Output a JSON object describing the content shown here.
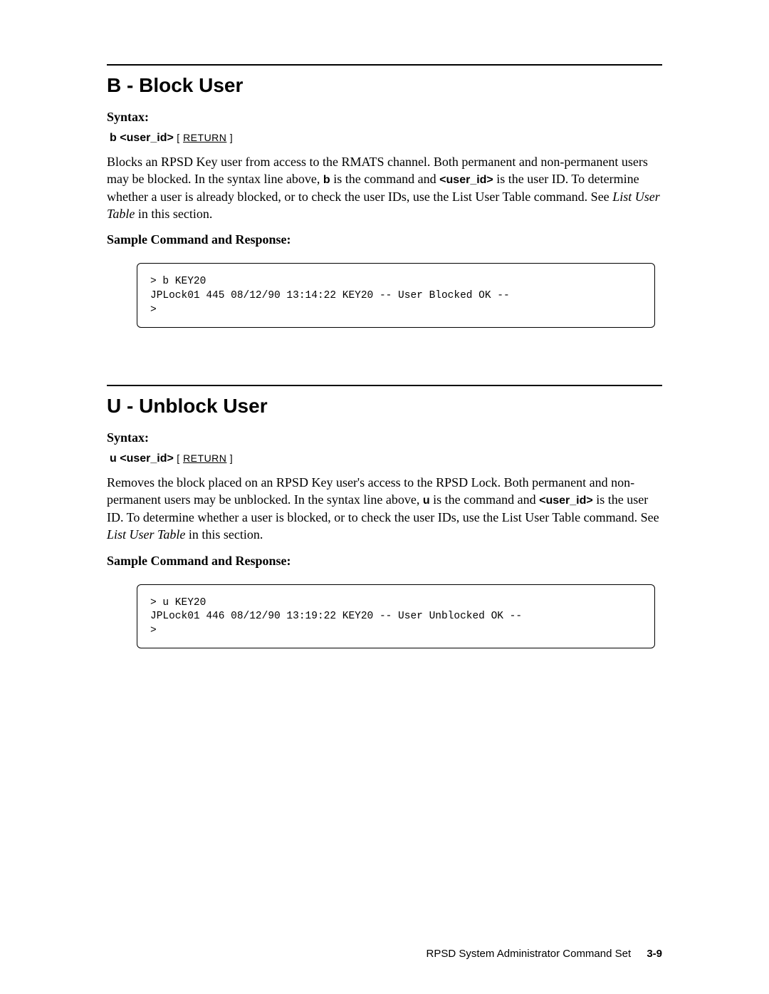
{
  "section1": {
    "title": "B - Block User",
    "syntax_label": "Syntax:",
    "syntax_cmd": "b <user_id>",
    "return_open": "[ ",
    "return_label": "RETURN",
    "return_close": " ]",
    "para_part1": "Blocks an RPSD Key user from access to the RMATS channel. Both permanent and non-permanent users may be blocked. In the syntax line above, ",
    "para_b": "b",
    "para_part2": " is the command and ",
    "para_userid": "<user_id>",
    "para_part3": " is the user ID. To determine whether a user is already blocked, or to check the user IDs, use the List User Table command. See ",
    "para_italic": "List User Table",
    "para_part4": " in this section.",
    "sample_label": "Sample Command and Response:",
    "code": "> b KEY20\nJPLock01 445 08/12/90 13:14:22 KEY20 -- User Blocked OK --\n>"
  },
  "section2": {
    "title": "U - Unblock User",
    "syntax_label": "Syntax:",
    "syntax_cmd": "u <user_id>",
    "return_open": "[ ",
    "return_label": "RETURN",
    "return_close": " ]",
    "para_part1": "Removes the block placed on an RPSD Key user's access to the RPSD Lock. Both permanent and non-permanent users may be unblocked. In the syntax line above, ",
    "para_u": "u",
    "para_part2": " is the command and ",
    "para_userid": "<user_id>",
    "para_part3": " is the user ID. To determine whether a user is blocked, or to check the user IDs, use the List User Table command. See ",
    "para_italic": "List User Table",
    "para_part4": " in this section.",
    "sample_label": "Sample Command and Response:",
    "code": "> u KEY20\nJPLock01 446 08/12/90 13:19:22 KEY20 -- User Unblocked OK --\n>"
  },
  "footer": {
    "text": "RPSD System Administrator Command Set",
    "page": "3-9"
  }
}
